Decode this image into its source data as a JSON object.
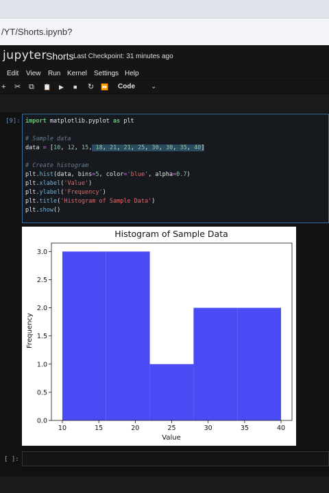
{
  "browser": {
    "url": "/YT/Shorts.ipynb?"
  },
  "header": {
    "logo": "jupyter",
    "notebook_title": "Shorts",
    "checkpoint": "Last Checkpoint: 31 minutes ago"
  },
  "menu": [
    "Edit",
    "View",
    "Run",
    "Kernel",
    "Settings",
    "Help"
  ],
  "toolbar": {
    "icons": [
      "add-icon",
      "cut-icon",
      "copy-icon",
      "paste-icon",
      "run-icon",
      "stop-icon",
      "restart-icon",
      "fast-forward-icon"
    ],
    "glyphs": [
      "+",
      "✂",
      "⧉",
      "📋",
      "▶",
      "■",
      "↻",
      "⏩"
    ],
    "cell_type": "Code"
  },
  "cell": {
    "prompt": "[9]:",
    "lines": [
      "import matplotlib.pyplot as plt",
      "",
      "# Sample data",
      "data = [10, 12, 15, 18, 21, 21, 25, 30, 30, 35, 40]",
      "",
      "# Create histogram",
      "plt.hist(data, bins=5, color='blue', alpha=0.7)",
      "plt.xlabel('Value')",
      "plt.ylabel('Frequency')",
      "plt.title('Histogram of Sample Data')",
      "plt.show()"
    ]
  },
  "empty_cell": {
    "prompt": "[ ]:"
  },
  "chart_data": {
    "type": "bar",
    "title": "Histogram of Sample Data",
    "xlabel": "Value",
    "ylabel": "Frequency",
    "bins": [
      [
        10,
        16
      ],
      [
        16,
        22
      ],
      [
        22,
        28
      ],
      [
        28,
        34
      ],
      [
        34,
        40
      ]
    ],
    "values": [
      3,
      3,
      1,
      2,
      2
    ],
    "xlim": [
      8.5,
      41.5
    ],
    "ylim": [
      0,
      3.15
    ],
    "xticks": [
      "10",
      "15",
      "20",
      "25",
      "30",
      "35",
      "40"
    ],
    "xtick_values": [
      10,
      15,
      20,
      25,
      30,
      35,
      40
    ],
    "yticks": [
      "0.0",
      "0.5",
      "1.0",
      "1.5",
      "2.0",
      "2.5",
      "3.0"
    ],
    "ytick_values": [
      0,
      0.5,
      1,
      1.5,
      2,
      2.5,
      3
    ],
    "color": "#4b4bf5"
  }
}
